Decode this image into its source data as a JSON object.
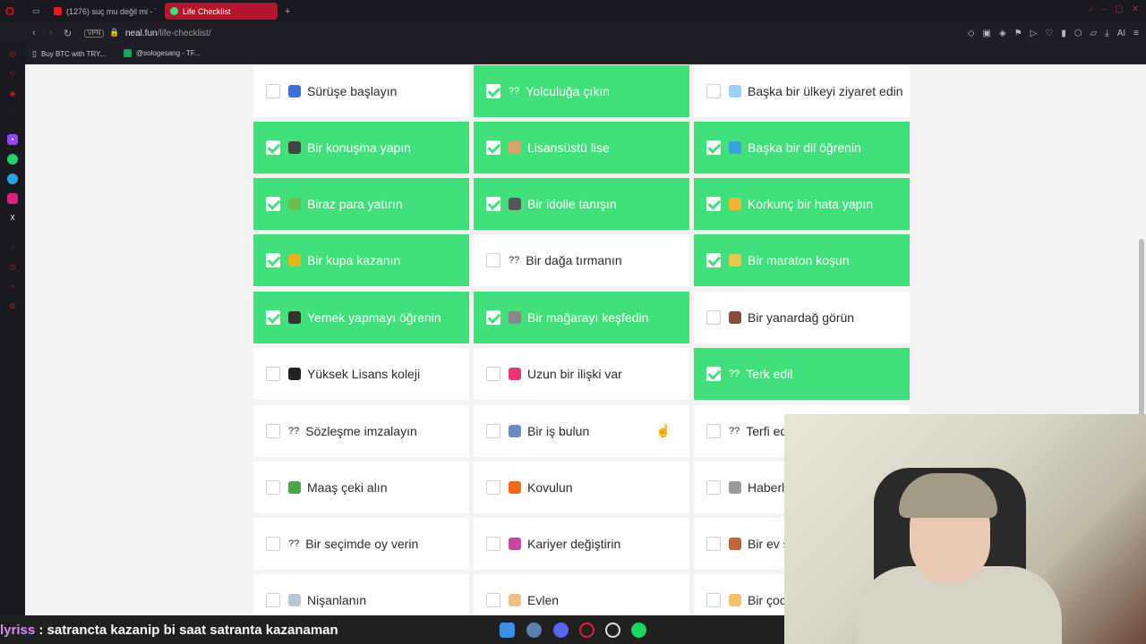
{
  "browser": {
    "tabs": [
      {
        "label": "(1276) suç mu değil mi - Y",
        "active": false,
        "color": "#e01e1e"
      },
      {
        "label": "Life Checklist",
        "active": true,
        "color": "#42e07a"
      }
    ],
    "new_tab": "+",
    "url_host": "neal.fun",
    "url_path": "/life-checklist/",
    "vpn": "VPN",
    "ai_label": "AI",
    "bookmarks": [
      {
        "label": "Buy BTC with TRY...",
        "icon": "bookmark-icon"
      },
      {
        "label": "@sologesang - TF...",
        "icon": "sheets-icon"
      }
    ]
  },
  "checklist": [
    {
      "label": "Sürüşe başlayın",
      "checked": false,
      "emoji": "car"
    },
    {
      "label": "Yolculuğa çıkın",
      "checked": true,
      "emoji": "??"
    },
    {
      "label": "Başka bir ülkeyi ziyaret edin",
      "checked": false,
      "emoji": "plane"
    },
    {
      "label": "Bir konuşma yapın",
      "checked": true,
      "emoji": "mic"
    },
    {
      "label": "Lisansüstü lise",
      "checked": true,
      "emoji": "school"
    },
    {
      "label": "Başka bir dil öğrenin",
      "checked": true,
      "emoji": "globe"
    },
    {
      "label": "Biraz para yatırın",
      "checked": true,
      "emoji": "money"
    },
    {
      "label": "Bir idolle tanışın",
      "checked": true,
      "emoji": "camera"
    },
    {
      "label": "Korkunç bir hata yapın",
      "checked": true,
      "emoji": "face"
    },
    {
      "label": "Bir kupa kazanın",
      "checked": true,
      "emoji": "trophy"
    },
    {
      "label": "Bir dağa tırmanın",
      "checked": false,
      "emoji": "??"
    },
    {
      "label": "Bir maraton koşun",
      "checked": true,
      "emoji": "runner"
    },
    {
      "label": "Yemek yapmayı öğrenin",
      "checked": true,
      "emoji": "pan"
    },
    {
      "label": "Bir mağarayı keşfedin",
      "checked": true,
      "emoji": "pick"
    },
    {
      "label": "Bir yanardağ görün",
      "checked": false,
      "emoji": "volcano"
    },
    {
      "label": "Yüksek Lisans koleji",
      "checked": false,
      "emoji": "grad"
    },
    {
      "label": "Uzun bir ilişki var",
      "checked": false,
      "emoji": "hearts"
    },
    {
      "label": "Terk edil",
      "checked": true,
      "emoji": "??"
    },
    {
      "label": "Sözleşme imzalayın",
      "checked": false,
      "emoji": "??"
    },
    {
      "label": "Bir iş bulun",
      "checked": false,
      "emoji": "building"
    },
    {
      "label": "Terfi edi",
      "checked": false,
      "emoji": "??"
    },
    {
      "label": "Maaş çeki alın",
      "checked": false,
      "emoji": "cash"
    },
    {
      "label": "Kovulun",
      "checked": false,
      "emoji": "fire"
    },
    {
      "label": "Haberle",
      "checked": false,
      "emoji": "news"
    },
    {
      "label": "Bir seçimde oy verin",
      "checked": false,
      "emoji": "??"
    },
    {
      "label": "Kariyer değiştirin",
      "checked": false,
      "emoji": "wheel"
    },
    {
      "label": "Bir ev s",
      "checked": false,
      "emoji": "house"
    },
    {
      "label": "Nişanlanın",
      "checked": false,
      "emoji": "ring"
    },
    {
      "label": "Evlen",
      "checked": false,
      "emoji": "bride"
    },
    {
      "label": "Bir çocu",
      "checked": false,
      "emoji": "baby"
    }
  ],
  "stream": {
    "chat_user": "lyriss",
    "chat_message": " : satrancta kazanip bi saat satranta kazanaman"
  },
  "colors": {
    "checked": "#42e07a",
    "accent": "#b3142e"
  }
}
